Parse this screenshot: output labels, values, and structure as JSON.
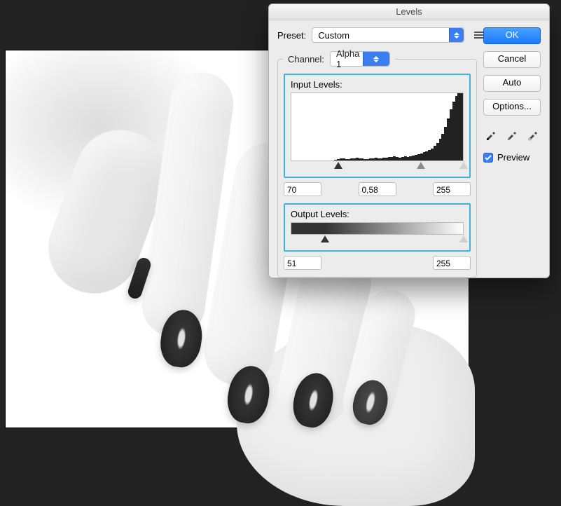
{
  "dialog": {
    "title": "Levels",
    "preset_label": "Preset:",
    "preset_value": "Custom",
    "channel_label": "Channel:",
    "channel_value": "Alpha 1",
    "input_levels_label": "Input Levels:",
    "output_levels_label": "Output Levels:",
    "input_black": "70",
    "input_gamma": "0,58",
    "input_white": "255",
    "output_black": "51",
    "output_white": "255",
    "histogram_range": [
      0,
      255
    ]
  },
  "buttons": {
    "ok": "OK",
    "cancel": "Cancel",
    "auto": "Auto",
    "options": "Options..."
  },
  "preview": {
    "label": "Preview",
    "checked": true
  },
  "colors": {
    "accent": "#3b7ef2",
    "highlight_border": "#3fb2e3"
  },
  "chart_data": {
    "type": "bar",
    "title": "Input Levels histogram",
    "xlabel": "",
    "ylabel": "",
    "xlim": [
      0,
      255
    ],
    "ylim": [
      0,
      100
    ],
    "categories_count": 64,
    "values": [
      0,
      0,
      0,
      0,
      0,
      0,
      0,
      0,
      0,
      0,
      0,
      0,
      0,
      0,
      0,
      0,
      1,
      2,
      3,
      3,
      2,
      2,
      3,
      3,
      4,
      3,
      3,
      2,
      2,
      3,
      3,
      4,
      3,
      3,
      4,
      4,
      5,
      5,
      6,
      5,
      4,
      5,
      6,
      5,
      6,
      7,
      8,
      9,
      10,
      12,
      14,
      16,
      18,
      22,
      26,
      32,
      40,
      50,
      62,
      76,
      88,
      96,
      100,
      100
    ],
    "markers": {
      "black": 70,
      "gamma": 0.58,
      "white": 255
    }
  }
}
